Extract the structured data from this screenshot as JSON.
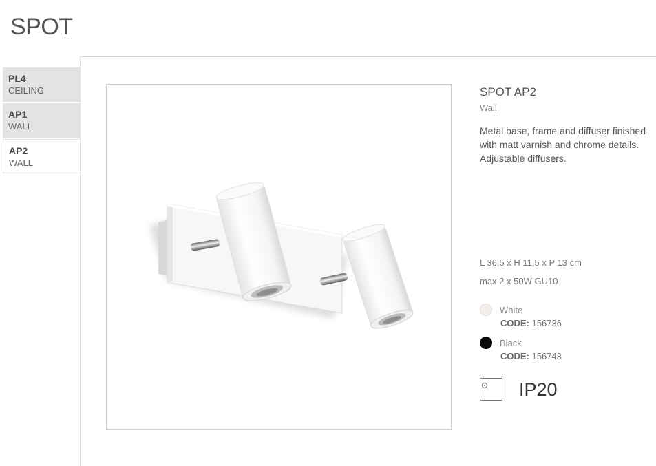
{
  "page": {
    "title": "SPOT"
  },
  "tabs": [
    {
      "code": "PL4",
      "type": "CEILING"
    },
    {
      "code": "AP1",
      "type": "WALL"
    },
    {
      "code": "AP2",
      "type": "WALL"
    }
  ],
  "product": {
    "name": "SPOT AP2",
    "category": "Wall",
    "description": "Metal base, frame and diffuser finished with matt varnish and chrome details. Adjustable diffusers.",
    "dimensions": "L 36,5 x H 11,5 x P 13 cm",
    "power": "max 2 x 50W GU10"
  },
  "variants": [
    {
      "color_name": "White",
      "code_label": "CODE:",
      "code": "156736",
      "swatch_color": "#f2eeec"
    },
    {
      "color_name": "Black",
      "code_label": "CODE:",
      "code": "156743",
      "swatch_color": "#0a0a0a"
    }
  ],
  "ip_rating": {
    "label": "IP20"
  },
  "colors": {
    "tab_inactive": "#e3e3e3",
    "text": "#555555",
    "rule": "#d6d6d6"
  }
}
